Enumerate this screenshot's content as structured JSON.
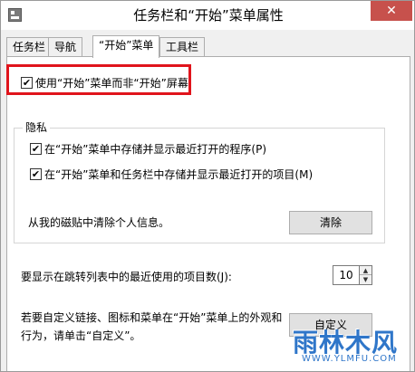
{
  "window": {
    "title": "任务栏和“开始”菜单属性"
  },
  "tabs": [
    {
      "label": "任务栏"
    },
    {
      "label": "导航"
    },
    {
      "label": "“开始”菜单"
    },
    {
      "label": "工具栏"
    }
  ],
  "panel": {
    "use_start_screen": {
      "label": "使用“开始”菜单而非“开始”屏幕",
      "checked": true
    },
    "privacy": {
      "title": "隐私",
      "option1": {
        "label": "在“开始”菜单中存储并显示最近打开的程序(P)",
        "checked": true
      },
      "option2": {
        "label": "在“开始”菜单和任务栏中存储并显示最近打开的项目(M)",
        "checked": true
      },
      "clear_text": "从我的磁贴中清除个人信息。",
      "clear_button": "清除"
    },
    "recent_items": {
      "label": "要显示在跳转列表中的最近使用的项目数(J):",
      "value": "10"
    },
    "customize": {
      "text_line1": "若要自定义链接、图标和菜单在“开始”菜单上的外观和",
      "text_line2": "行为，请单击“自定义”。",
      "button": "自定义"
    }
  },
  "watermark": {
    "name": "雨林木风",
    "url": "WWW.YLMFU.COM"
  },
  "colors": {
    "highlight": "#e0141c",
    "close": "#c7514c",
    "watermark": "#2f76c9"
  }
}
